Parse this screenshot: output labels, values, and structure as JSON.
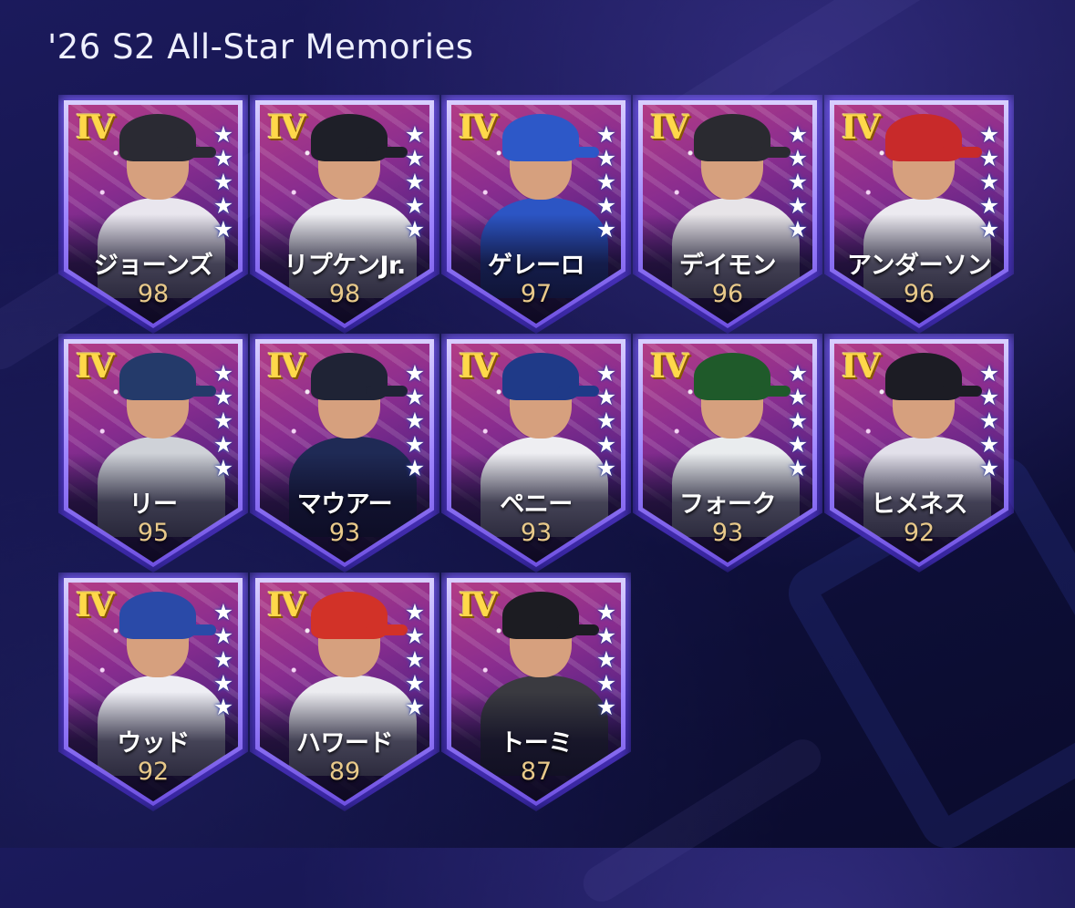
{
  "header": {
    "title": "'26 S2 All-Star Memories"
  },
  "colors": {
    "tier_gold": "#ffd84a",
    "card_frame": "#9f86ff",
    "rating_text": "#e8c98a",
    "background": "#141449"
  },
  "cards": [
    {
      "tier": "IV",
      "name": "ジョーンズ",
      "rating": "98",
      "helmet_color": "#2a2a33",
      "torso_color": "#e9e6ee"
    },
    {
      "tier": "IV",
      "name": "リプケンJr.",
      "rating": "98",
      "helmet_color": "#1e1f28",
      "torso_color": "#eeeef2"
    },
    {
      "tier": "IV",
      "name": "ゲレーロ",
      "rating": "97",
      "helmet_color": "#2d58c8",
      "torso_color": "#2c55c4"
    },
    {
      "tier": "IV",
      "name": "デイモン",
      "rating": "96",
      "helmet_color": "#2a2a30",
      "torso_color": "#e7e4e8"
    },
    {
      "tier": "IV",
      "name": "アンダーソン",
      "rating": "96",
      "helmet_color": "#c82a2a",
      "torso_color": "#eceaf0"
    },
    {
      "tier": "IV",
      "name": "リー",
      "rating": "95",
      "helmet_color": "#243a6a",
      "torso_color": "#cfd2d8"
    },
    {
      "tier": "IV",
      "name": "マウアー",
      "rating": "93",
      "helmet_color": "#1f2335",
      "torso_color": "#1f2a55"
    },
    {
      "tier": "IV",
      "name": "ペニー",
      "rating": "93",
      "helmet_color": "#1f3a88",
      "torso_color": "#eeeef2"
    },
    {
      "tier": "IV",
      "name": "フォーク",
      "rating": "93",
      "helmet_color": "#1f5a2a",
      "torso_color": "#e9ecee"
    },
    {
      "tier": "IV",
      "name": "ヒメネス",
      "rating": "92",
      "helmet_color": "#1c1c24",
      "torso_color": "#e2e0ea"
    },
    {
      "tier": "IV",
      "name": "ウッド",
      "rating": "92",
      "helmet_color": "#2a4aa8",
      "torso_color": "#eeeef4"
    },
    {
      "tier": "IV",
      "name": "ハワード",
      "rating": "89",
      "helmet_color": "#d23228",
      "torso_color": "#ececf0"
    },
    {
      "tier": "IV",
      "name": "トーミ",
      "rating": "87",
      "helmet_color": "#1c1c22",
      "torso_color": "#3a3a40"
    }
  ],
  "stars_per_card": 5,
  "star_glyph": "★"
}
